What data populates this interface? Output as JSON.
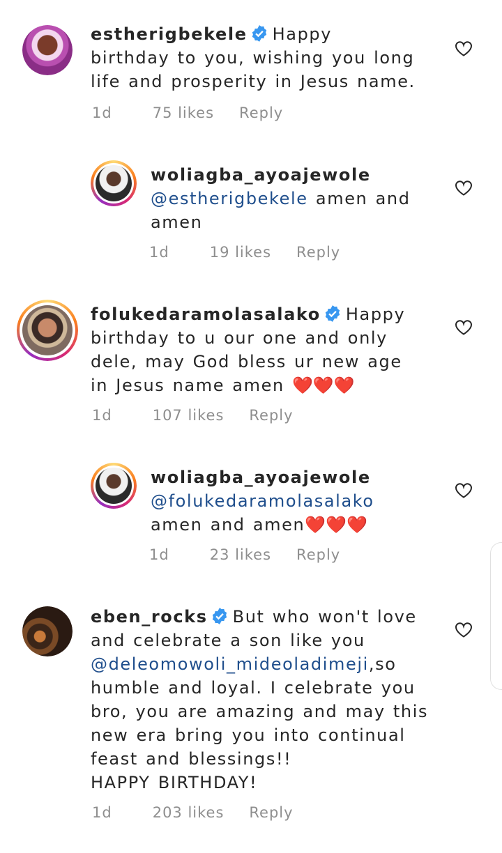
{
  "comments": [
    {
      "username": "estherigbekele",
      "verified": true,
      "text": "Happy birthday to you, wishing you long life and prosperity in Jesus name.",
      "time": "1d",
      "likes": "75 likes",
      "reply": "Reply"
    },
    {
      "username": "woliagba_ayoajewole",
      "verified": false,
      "mention": "@estherigbekele",
      "text": "amen and amen",
      "time": "1d",
      "likes": "19 likes",
      "reply": "Reply"
    },
    {
      "username": "folukedaramolasalako",
      "verified": true,
      "text": "Happy birthday to u our one and only dele, may God bless ur new age in Jesus name amen",
      "emoji": "❤️❤️❤️",
      "time": "1d",
      "likes": "107 likes",
      "reply": "Reply"
    },
    {
      "username": "woliagba_ayoajewole",
      "verified": false,
      "mention": "@folukedaramolasalako",
      "text": "amen and amen",
      "emoji": "❤️❤️❤️",
      "time": "1d",
      "likes": "23 likes",
      "reply": "Reply"
    },
    {
      "username": "eben_rocks",
      "verified": true,
      "text_before": "But who won't love and celebrate a son like you",
      "mention": "@deleomowoli_mideoladimeji",
      "text_after": ",so humble and loyal. I celebrate you bro, you are amazing and may this new era bring you into continual feast and blessings!!",
      "text_last": "HAPPY BIRTHDAY!",
      "time": "1d",
      "likes": "203 likes",
      "reply": "Reply"
    }
  ],
  "icons": {
    "like": "heart-outline-icon",
    "verified": "verified-badge-icon"
  },
  "colors": {
    "verified": "#3897f0",
    "mention": "#1f4e8c",
    "meta": "#8e8e8e",
    "heart": "#e02424"
  }
}
